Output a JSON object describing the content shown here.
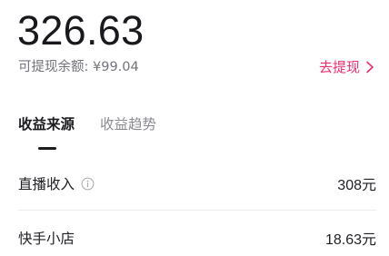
{
  "balance": "326.63",
  "withdrawable": {
    "label": "可提现余额:",
    "amount": "¥99.04"
  },
  "withdraw_link": {
    "label": "去提现",
    "icon": "chevron-right-icon"
  },
  "tabs": [
    {
      "label": "收益来源",
      "active": true
    },
    {
      "label": "收益趋势",
      "active": false
    }
  ],
  "income_rows": [
    {
      "label": "直播收入",
      "value": "308元",
      "icon": "info-icon"
    },
    {
      "label": "快手小店",
      "value": "18.63元"
    }
  ],
  "colors": {
    "accent": "#ee2d6d",
    "text": "#1f1f24",
    "muted": "#73737c"
  }
}
